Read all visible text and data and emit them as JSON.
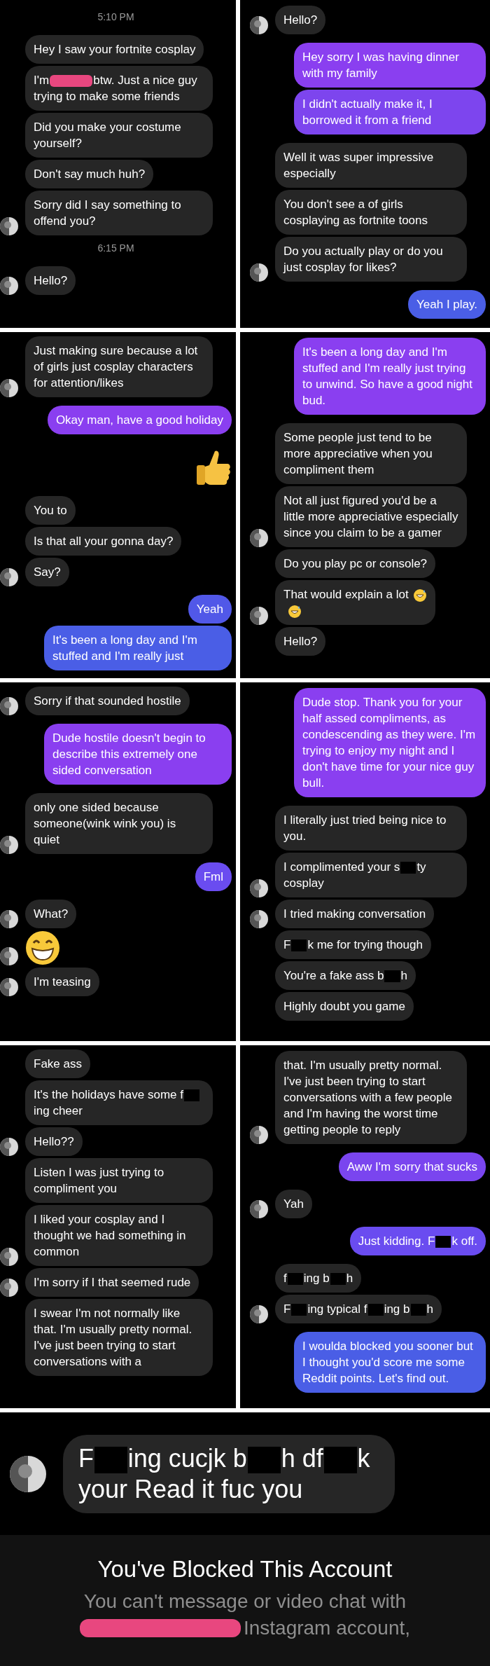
{
  "panels": [
    {
      "messages": [
        {
          "kind": "time",
          "text": "5:10 PM"
        },
        {
          "kind": "received",
          "text": "Hey I saw your fortnite cosplay",
          "avatar": false
        },
        {
          "kind": "received",
          "parts": [
            "I'm",
            "btw. Just a nice guy trying to make some friends"
          ],
          "scribbled": true,
          "avatar": false
        },
        {
          "kind": "received",
          "text": "Did you make your costume yourself?",
          "avatar": false
        },
        {
          "kind": "received",
          "text": "Don't say much huh?",
          "avatar": false
        },
        {
          "kind": "received",
          "text": "Sorry did I say something to offend you?",
          "avatar": true
        },
        {
          "kind": "time",
          "text": "6:15 PM"
        },
        {
          "kind": "received",
          "text": "Hello?",
          "avatar": true
        }
      ]
    },
    {
      "messages": [
        {
          "kind": "received",
          "text": "Hello?",
          "avatar": true
        },
        {
          "kind": "sent",
          "text": "Hey sorry I was having dinner with my family",
          "color": "#8a3ff0"
        },
        {
          "kind": "sent",
          "text": "I didn't actually make it, I borrowed it from a friend",
          "color": "#7d45ee"
        },
        {
          "kind": "received",
          "text": "Well it was super impressive especially",
          "avatar": false
        },
        {
          "kind": "received",
          "text": "You don't see a of girls cosplaying as fortnite toons",
          "avatar": false
        },
        {
          "kind": "received",
          "text": "Do you actually play or do you just cosplay for likes?",
          "avatar": true
        },
        {
          "kind": "sent",
          "text": "Yeah I play.",
          "color": "#4a5ee6"
        }
      ]
    },
    {
      "messages": [
        {
          "kind": "received",
          "text": "Just making sure because a lot of girls just cosplay characters for attention/likes",
          "avatar": true
        },
        {
          "kind": "sent",
          "text": "Okay man, have a good holiday",
          "color": "#8a3ff0"
        },
        {
          "kind": "thumbs-up"
        },
        {
          "kind": "received",
          "text": "You to",
          "avatar": false
        },
        {
          "kind": "received",
          "text": "Is that all your gonna day?",
          "avatar": false
        },
        {
          "kind": "received",
          "text": "Say?",
          "avatar": true
        },
        {
          "kind": "sent",
          "text": "Yeah",
          "color": "#5158e8"
        },
        {
          "kind": "sent",
          "text": "It's been a long day and I'm stuffed and I'm really just",
          "color": "#4a5ee6"
        }
      ]
    },
    {
      "messages": [
        {
          "kind": "sent",
          "text": "It's been a long day and I'm stuffed and I'm really just trying to unwind. So have a good night bud.",
          "color": "#8a3ff0"
        },
        {
          "kind": "received",
          "text": "Some people just tend to be more appreciative when you compliment them",
          "avatar": false
        },
        {
          "kind": "received",
          "text": "Not all just figured you'd be a little more appreciative especially since you claim to be a gamer",
          "avatar": true
        },
        {
          "kind": "received",
          "text": "Do you play pc or console?",
          "avatar": false
        },
        {
          "kind": "received-emoji",
          "text": "That would explain a lot",
          "avatar": true
        },
        {
          "kind": "received",
          "text": "Hello?",
          "avatar": false
        }
      ]
    },
    {
      "messages": [
        {
          "kind": "received",
          "text": "Sorry if that sounded hostile",
          "avatar": true
        },
        {
          "kind": "sent",
          "text": "Dude hostile doesn't begin to describe this extremely one sided conversation",
          "color": "#8a3ff0"
        },
        {
          "kind": "received",
          "text": "only one sided because someone(wink wink you) is quiet",
          "avatar": true
        },
        {
          "kind": "sent",
          "text": "Fml",
          "color": "#6a4cf0"
        },
        {
          "kind": "received",
          "text": "What?",
          "avatar": true
        },
        {
          "kind": "grin",
          "avatar": true
        },
        {
          "kind": "received",
          "text": "I'm teasing",
          "avatar": true
        }
      ]
    },
    {
      "messages": [
        {
          "kind": "sent",
          "text": "Dude stop. Thank you for your half assed compliments, as condescending as they were. I'm trying to enjoy my night and I don't have time for your nice guy bull.",
          "color": "#8a3ff0"
        },
        {
          "kind": "received",
          "text": "I literally just tried being nice to you.",
          "avatar": false
        },
        {
          "kind": "received",
          "parts": [
            "I complimented your s",
            "ty cosplay"
          ],
          "scribbled": false,
          "avatar": true
        },
        {
          "kind": "received",
          "text": "I tried making conversation",
          "avatar": true
        },
        {
          "kind": "received",
          "parts": [
            "F",
            "k me for trying though"
          ],
          "scribbled": false,
          "avatar": false
        },
        {
          "kind": "received",
          "parts": [
            "You're a fake ass b",
            "h"
          ],
          "scribbled": false,
          "avatar": false
        },
        {
          "kind": "received",
          "text": "Highly doubt you game",
          "avatar": false
        }
      ]
    },
    {
      "messages": [
        {
          "kind": "received",
          "text": "Fake ass",
          "avatar": false
        },
        {
          "kind": "received",
          "parts": [
            "It's the holidays have some f",
            "ing cheer"
          ],
          "scribbled": false,
          "avatar": false
        },
        {
          "kind": "received",
          "text": "Hello??",
          "avatar": true
        },
        {
          "kind": "received",
          "text": "Listen I was just trying to compliment you",
          "avatar": false
        },
        {
          "kind": "received",
          "text": "I liked your cosplay and I thought we had something in common",
          "avatar": true
        },
        {
          "kind": "received",
          "text": "I'm sorry if I that seemed rude",
          "avatar": true
        },
        {
          "kind": "received",
          "text": "I swear I'm not normally like that. I'm usually pretty normal. I've just been trying to start conversations with a",
          "avatar": false
        }
      ]
    },
    {
      "messages": [
        {
          "kind": "received",
          "text": "that. I'm usually pretty normal. I've just been trying to start conversations with a few people and I'm having the worst time getting people to reply",
          "avatar": true
        },
        {
          "kind": "sent",
          "text": "Aww I'm sorry that sucks",
          "color": "#7a45ef"
        },
        {
          "kind": "received",
          "text": "Yah",
          "avatar": true
        },
        {
          "kind": "sent",
          "parts": [
            "Just kidding. F",
            "k off."
          ],
          "scribbled": false,
          "color": "#6a4cf0"
        },
        {
          "kind": "received",
          "parts": [
            "f",
            "ing b",
            "h"
          ],
          "scribbled": false,
          "avatar": false
        },
        {
          "kind": "received",
          "parts": [
            "F",
            "ing typical f",
            "ing b",
            "h"
          ],
          "scribbled": false,
          "avatar": true
        },
        {
          "kind": "sent",
          "text": "I woulda blocked you sooner but I thought you'd score me some Reddit points. Let's find out.",
          "color": "#4a5ee6"
        }
      ]
    }
  ],
  "final_message": {
    "parts": [
      "F",
      "ing cucjk b",
      "h df",
      "k your Read it fuc you"
    ],
    "scribbled": false,
    "avatar": true
  },
  "blocked_notice": {
    "title": "You've Blocked This Account",
    "body_lines": [
      {
        "text": "You can't message or video chat with",
        "scribble": false
      },
      {
        "text": "Instagram account,",
        "scribble": true
      }
    ]
  }
}
